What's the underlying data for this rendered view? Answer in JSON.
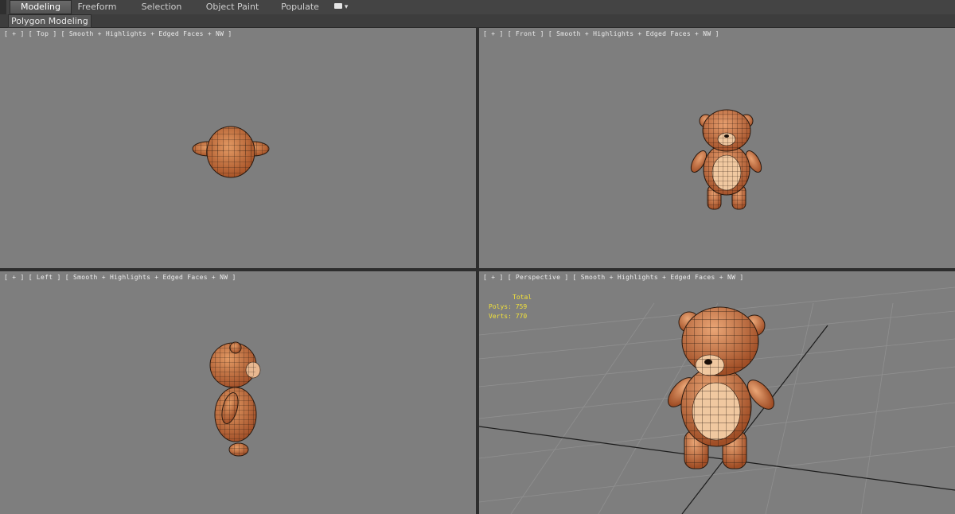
{
  "ribbon": {
    "tabs": [
      {
        "label": "Modeling",
        "active": true
      },
      {
        "label": "Freeform",
        "active": false
      },
      {
        "label": "Selection",
        "active": false
      },
      {
        "label": "Object Paint",
        "active": false
      },
      {
        "label": "Populate",
        "active": false
      }
    ],
    "options_icon": "ribbon-options-icon",
    "panel_label": "Polygon Modeling"
  },
  "viewports": {
    "top": {
      "label": "[ + ] [ Top ] [ Smooth + Highlights + Edged Faces + NW ]"
    },
    "front": {
      "label": "[ + ] [ Front ] [ Smooth + Highlights + Edged Faces + NW ]"
    },
    "left": {
      "label": "[ + ] [ Left ] [ Smooth + Highlights + Edged Faces + NW ]"
    },
    "perspective": {
      "label": "[ + ] [ Perspective ] [ Smooth + Highlights + Edged Faces + NW ]"
    }
  },
  "stats": {
    "header": "Total",
    "polys_label": "Polys:",
    "polys_value": "759",
    "verts_label": "Verts:",
    "verts_value": "770"
  },
  "colors": {
    "viewport_bg": "#7e7e7e",
    "model_fill": "#c8703c",
    "model_light": "#f0c8a0",
    "wire": "#2a1a10",
    "stats_text": "#f2e23a"
  }
}
